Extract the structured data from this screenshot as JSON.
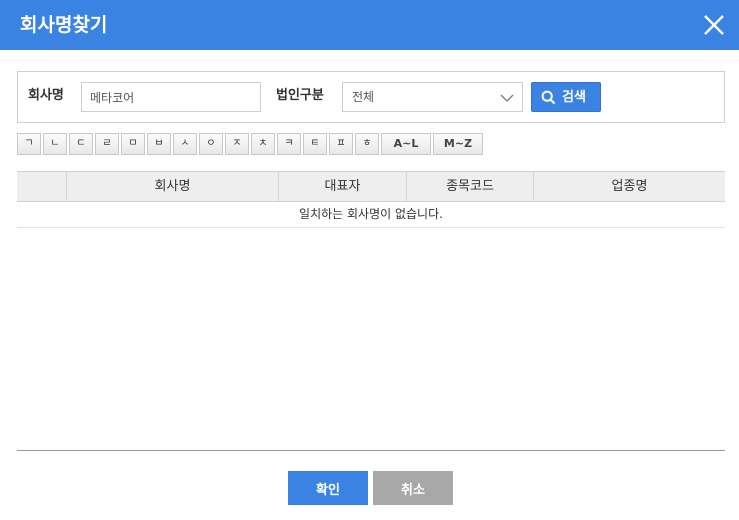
{
  "dialog": {
    "title": "회사명찾기",
    "close_icon": "close-icon"
  },
  "search": {
    "company_label": "회사명",
    "company_value": "메타코어",
    "type_label": "법인구분",
    "type_selected": "전체",
    "search_button": "검색",
    "search_icon": "search-icon"
  },
  "letters": [
    "ㄱ",
    "ㄴ",
    "ㄷ",
    "ㄹ",
    "ㅁ",
    "ㅂ",
    "ㅅ",
    "ㅇ",
    "ㅈ",
    "ㅊ",
    "ㅋ",
    "ㅌ",
    "ㅍ",
    "ㅎ",
    "A~L",
    "M~Z"
  ],
  "table": {
    "columns": [
      "",
      "회사명",
      "대표자",
      "종목코드",
      "업종명"
    ],
    "empty_message": "일치하는 회사명이 없습니다."
  },
  "footer": {
    "ok_button": "확인",
    "cancel_button": "취소"
  },
  "colors": {
    "accent": "#3b83e3",
    "cancel": "#a8a8a8"
  }
}
